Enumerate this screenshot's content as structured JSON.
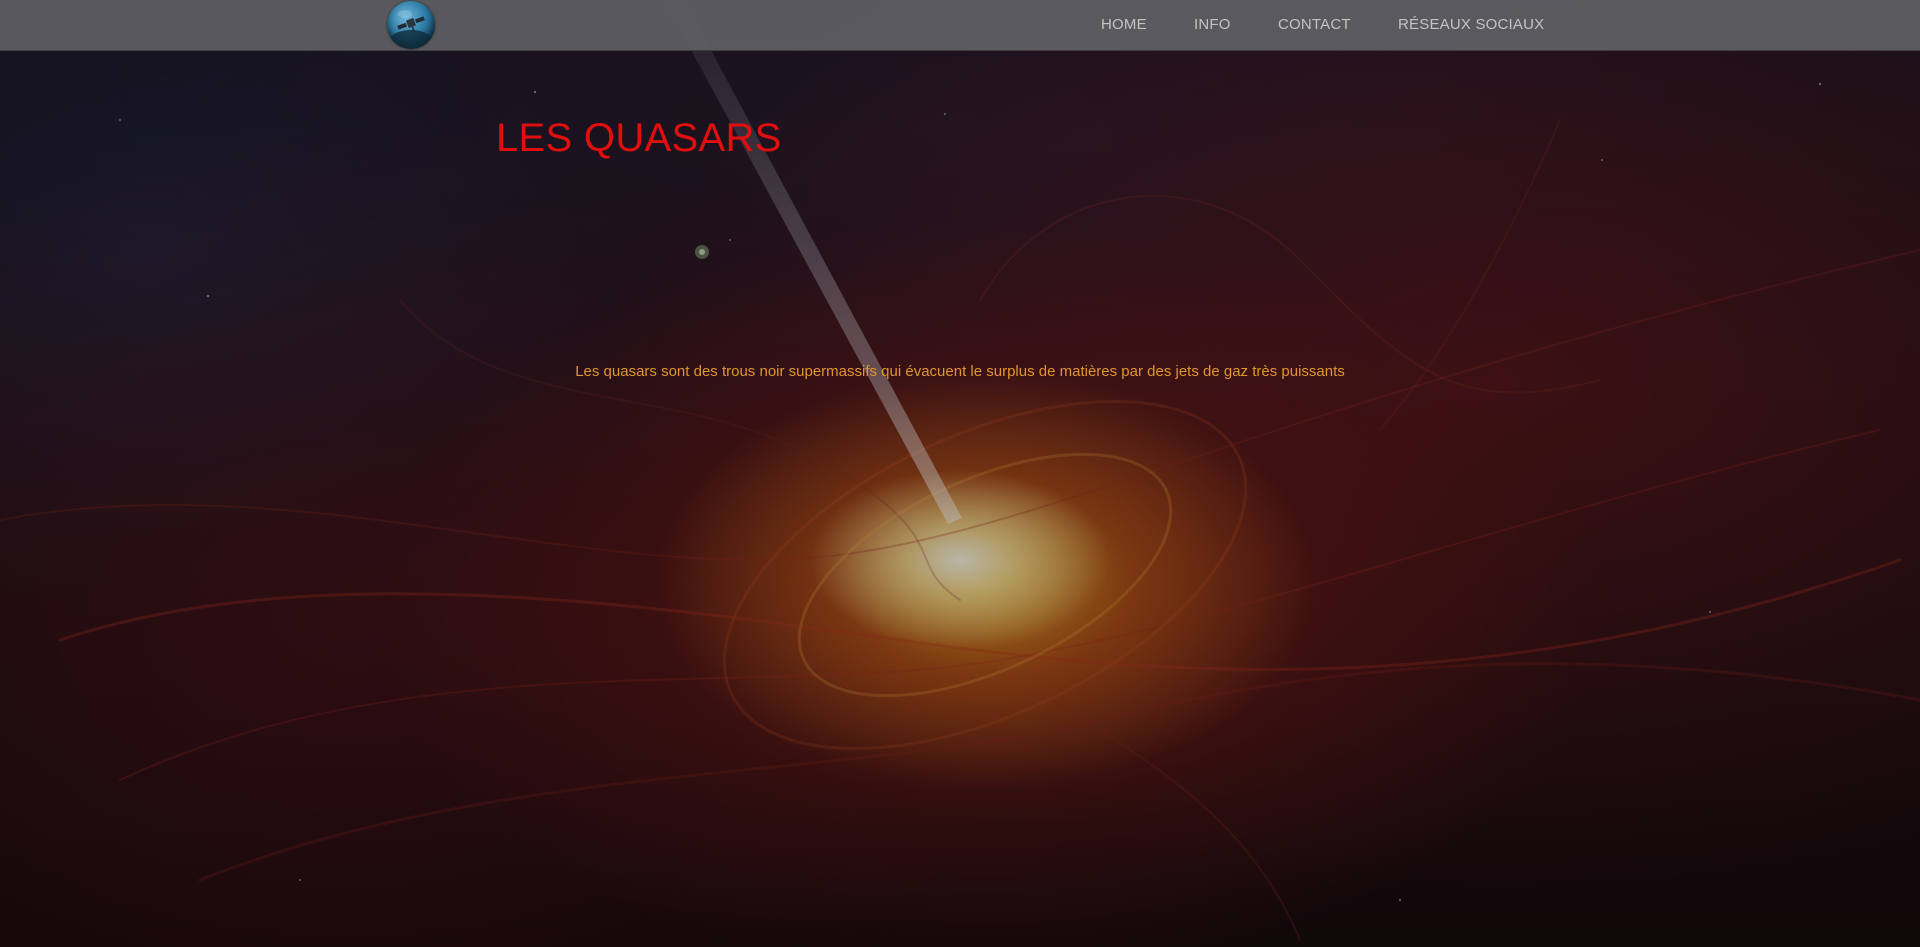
{
  "header": {
    "logo_icon": "satellite-globe-logo",
    "nav": [
      {
        "label": "HOME"
      },
      {
        "label": "INFO"
      },
      {
        "label": "CONTACT"
      },
      {
        "label": "RÉSEAUX SOCIAUX"
      }
    ]
  },
  "main": {
    "title": "LES QUASARS",
    "description": "Les quasars sont des trous noir supermassifs qui évacuent le surplus de matières par des jets de gaz très puissants"
  },
  "colors": {
    "title": "#e10e0e",
    "description": "#e0962e",
    "navbar": "#5f5f62",
    "nav_text": "#c3c3c3"
  }
}
